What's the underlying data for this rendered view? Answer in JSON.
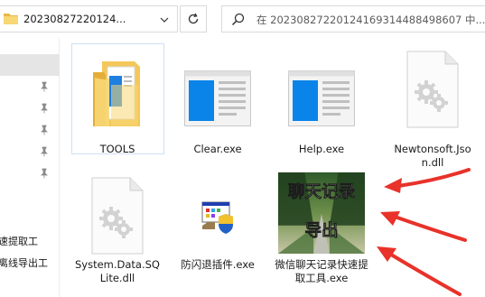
{
  "address": {
    "path": "20230827220124...",
    "search_placeholder": "在 20230827220124169314488498607 中..."
  },
  "nav": {
    "items": [
      {
        "label": "速提取工"
      },
      {
        "label": "离线导出工"
      }
    ]
  },
  "files": [
    {
      "name": "TOOLS",
      "type": "folder"
    },
    {
      "name": "Clear.exe",
      "type": "exe-window"
    },
    {
      "name": "Help.exe",
      "type": "exe-window"
    },
    {
      "name": "Newtonsoft.Json.dll",
      "type": "dll"
    },
    {
      "name": "System.Data.SQLite.dll",
      "type": "dll"
    },
    {
      "name": "防闪退插件.exe",
      "type": "installer"
    },
    {
      "name": "微信聊天记录快速提取工具.exe",
      "type": "app-thumbnail",
      "thumb_text_1": "聊天记录",
      "thumb_text_2": "导出"
    }
  ],
  "colors": {
    "accent": "#0078d7",
    "arrow": "#e8322a",
    "selection": "#e5e5e5",
    "folder": "#f8d775"
  }
}
